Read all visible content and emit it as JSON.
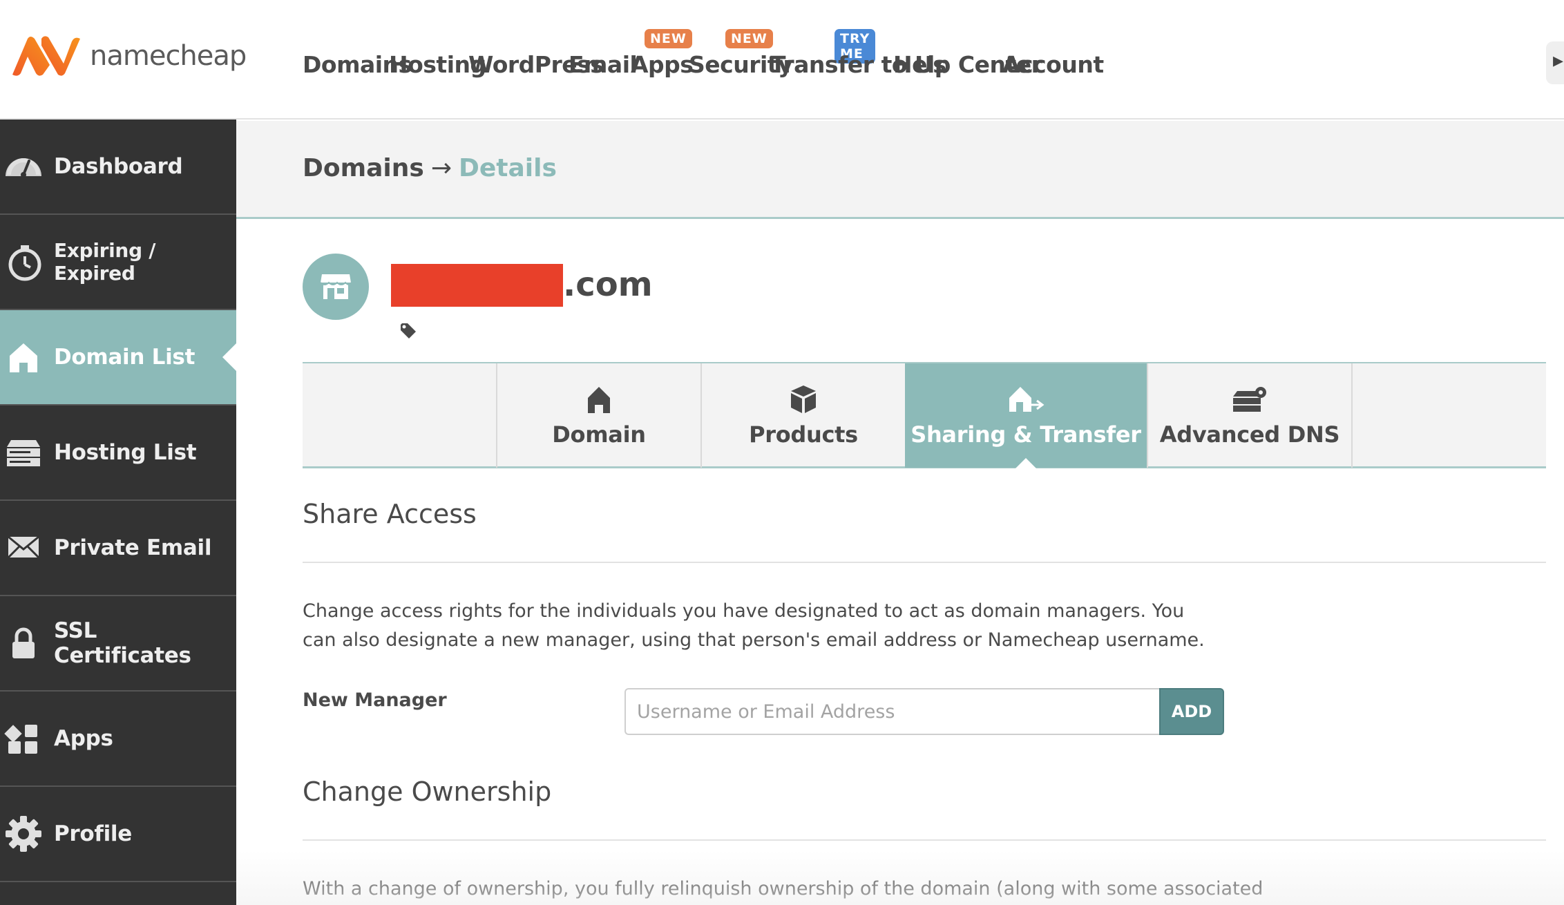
{
  "brand": {
    "name": "namecheap"
  },
  "nav": {
    "items": [
      {
        "label": "Domains"
      },
      {
        "label": "Hosting"
      },
      {
        "label": "WordPress"
      },
      {
        "label": "Email"
      },
      {
        "label": "Apps",
        "badge": "NEW"
      },
      {
        "label": "Security",
        "badge": "NEW"
      },
      {
        "label": "Transfer to Us",
        "badge": "TRY ME"
      },
      {
        "label": "Help Center"
      },
      {
        "label": "Account"
      }
    ]
  },
  "sidebar": {
    "items": [
      {
        "label": "Dashboard",
        "icon": "speedometer-icon"
      },
      {
        "label": "Expiring / Expired",
        "icon": "timer-icon"
      },
      {
        "label": "Domain List",
        "icon": "home-icon",
        "active": true
      },
      {
        "label": "Hosting List",
        "icon": "server-icon"
      },
      {
        "label": "Private Email",
        "icon": "envelope-icon"
      },
      {
        "label": "SSL Certificates",
        "icon": "lock-icon"
      },
      {
        "label": "Apps",
        "icon": "apps-grid-icon"
      },
      {
        "label": "Profile",
        "icon": "gear-icon"
      }
    ]
  },
  "breadcrumb": {
    "parent": "Domains",
    "separator": "→",
    "current": "Details"
  },
  "domain": {
    "tld": ".com",
    "icon": "storefront-icon"
  },
  "tabs": [
    {
      "label": "",
      "icon": ""
    },
    {
      "label": "Domain",
      "icon": "home-icon"
    },
    {
      "label": "Products",
      "icon": "package-icon"
    },
    {
      "label": "Sharing & Transfer",
      "icon": "home-transfer-icon",
      "active": true
    },
    {
      "label": "Advanced DNS",
      "icon": "dns-server-gear-icon"
    },
    {
      "label": "",
      "icon": ""
    }
  ],
  "share_access": {
    "title": "Share Access",
    "description": "Change access rights for the individuals you have designated to act as domain managers. You can also designate a new manager, using that person's email address or Namecheap username.",
    "new_manager_label": "New Manager",
    "input_placeholder": "Username or Email Address",
    "add_label": "ADD"
  },
  "change_ownership": {
    "title": "Change Ownership",
    "description": "With a change of ownership, you fully relinquish ownership of the domain (along with some associated"
  },
  "colors": {
    "accent": "#8cbab8",
    "sidebar_bg": "#333333",
    "badge_new": "#e7804a",
    "badge_try": "#4a89d6",
    "redaction": "#e8402a",
    "add_button": "#5b8e90"
  }
}
